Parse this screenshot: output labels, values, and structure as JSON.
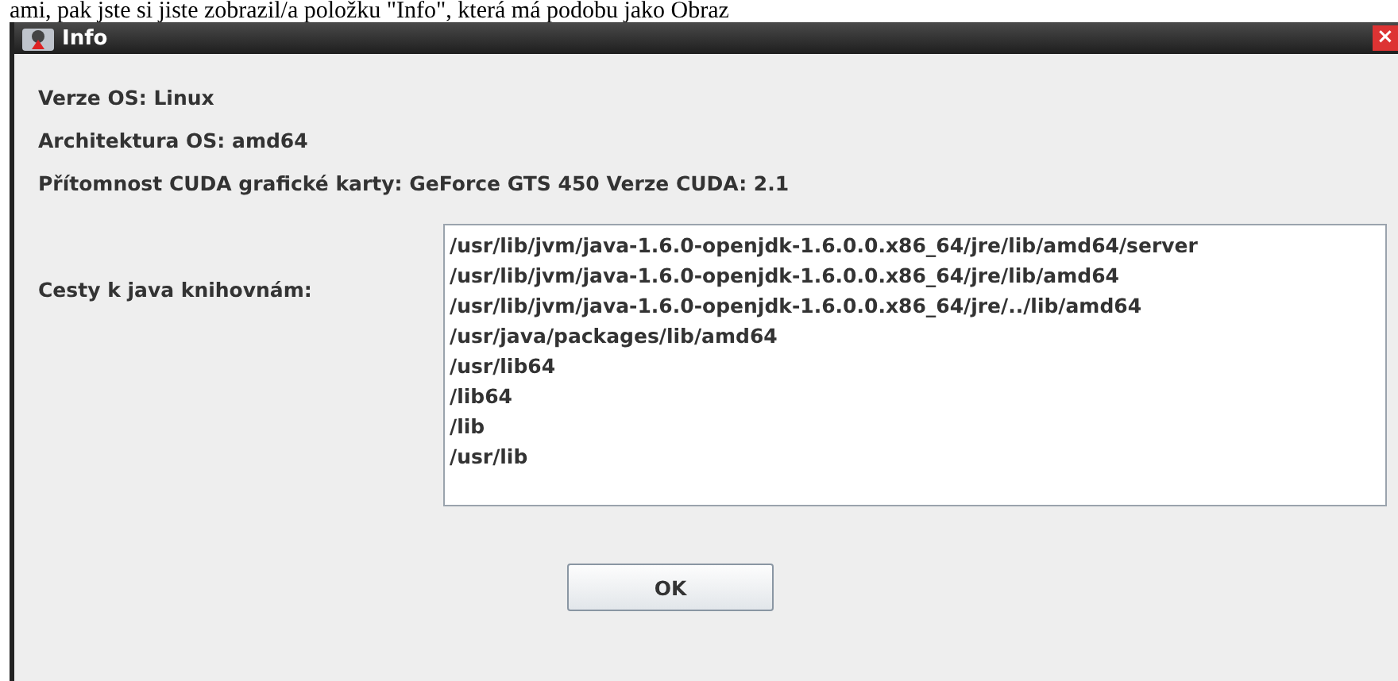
{
  "document_text": "ami, pak jste si jiste zobrazil/a položku \"Info\", která má podobu jako Obraz",
  "window": {
    "title": "Info",
    "close": "×"
  },
  "info_lines": [
    "Verze OS: Linux",
    "Architektura OS: amd64",
    "Přítomnost CUDA grafické karty: GeForce GTS 450 Verze CUDA: 2.1"
  ],
  "paths": {
    "label": "Cesty k java knihovnám:",
    "lines": [
      "/usr/lib/jvm/java-1.6.0-openjdk-1.6.0.0.x86_64/jre/lib/amd64/server",
      "/usr/lib/jvm/java-1.6.0-openjdk-1.6.0.0.x86_64/jre/lib/amd64",
      "/usr/lib/jvm/java-1.6.0-openjdk-1.6.0.0.x86_64/jre/../lib/amd64",
      "/usr/java/packages/lib/amd64",
      "/usr/lib64",
      "/lib64",
      "/lib",
      "/usr/lib"
    ]
  },
  "buttons": [
    "OK"
  ]
}
